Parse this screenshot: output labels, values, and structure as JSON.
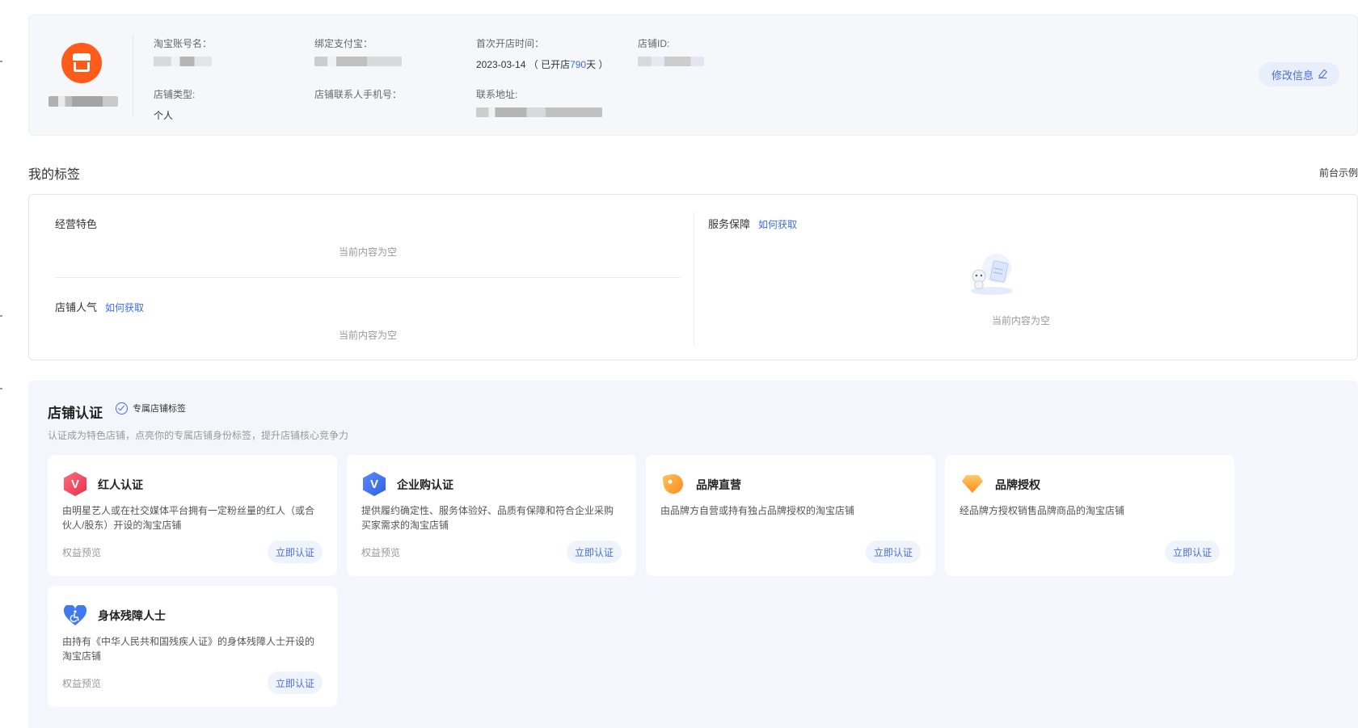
{
  "shop_info": {
    "account_label": "淘宝账号名：",
    "alipay_label": "绑定支付宝：",
    "open_time_label": "首次开店时间：",
    "open_date": "2023-03-14",
    "open_days_prefix": "（ 已开店",
    "open_days": "790",
    "open_days_suffix": "天 ）",
    "shop_id_label": "店铺ID:",
    "shop_type_label": "店铺类型:",
    "shop_type_value": "个人",
    "phone_label": "店铺联系人手机号：",
    "address_label": "联系地址:",
    "edit_button": "修改信息"
  },
  "my_tags": {
    "title": "我的标签",
    "front_example": "前台示例",
    "business_feature": "经营特色",
    "shop_popularity": "店铺人气",
    "service_guarantee": "服务保障",
    "how_to_get": "如何获取",
    "empty_text": "当前内容为空"
  },
  "certification": {
    "title": "店铺认证",
    "badge": "专属店铺标签",
    "subtitle": "认证成为特色店铺，点亮你的专属店铺身份标签，提升店铺核心竞争力",
    "preview_label": "权益预览",
    "certify_button": "立即认证",
    "cards": [
      {
        "title": "红人认证",
        "icon": "red-v-hexagon-icon",
        "desc": "由明星艺人或在社交媒体平台拥有一定粉丝量的红人（或合伙人/股东）开设的淘宝店铺"
      },
      {
        "title": "企业购认证",
        "icon": "blue-v-hexagon-icon",
        "desc": "提供履约确定性、服务体验好、品质有保障和符合企业采购买家需求的淘宝店铺"
      },
      {
        "title": "品牌直营",
        "icon": "orange-tag-icon",
        "desc": "由品牌方自营或持有独占品牌授权的淘宝店铺"
      },
      {
        "title": "品牌授权",
        "icon": "orange-gem-icon",
        "desc": "经品牌方授权销售品牌商品的淘宝店铺"
      },
      {
        "title": "身体残障人士",
        "icon": "blue-heart-accessibility-icon",
        "desc": "由持有《中华人民共和国残疾人证》的身体残障人士开设的淘宝店铺"
      }
    ]
  },
  "colors": {
    "accent": "#3f6ce8",
    "logo": "#ff5b1a",
    "panel_bg": "#f3f6fc"
  }
}
